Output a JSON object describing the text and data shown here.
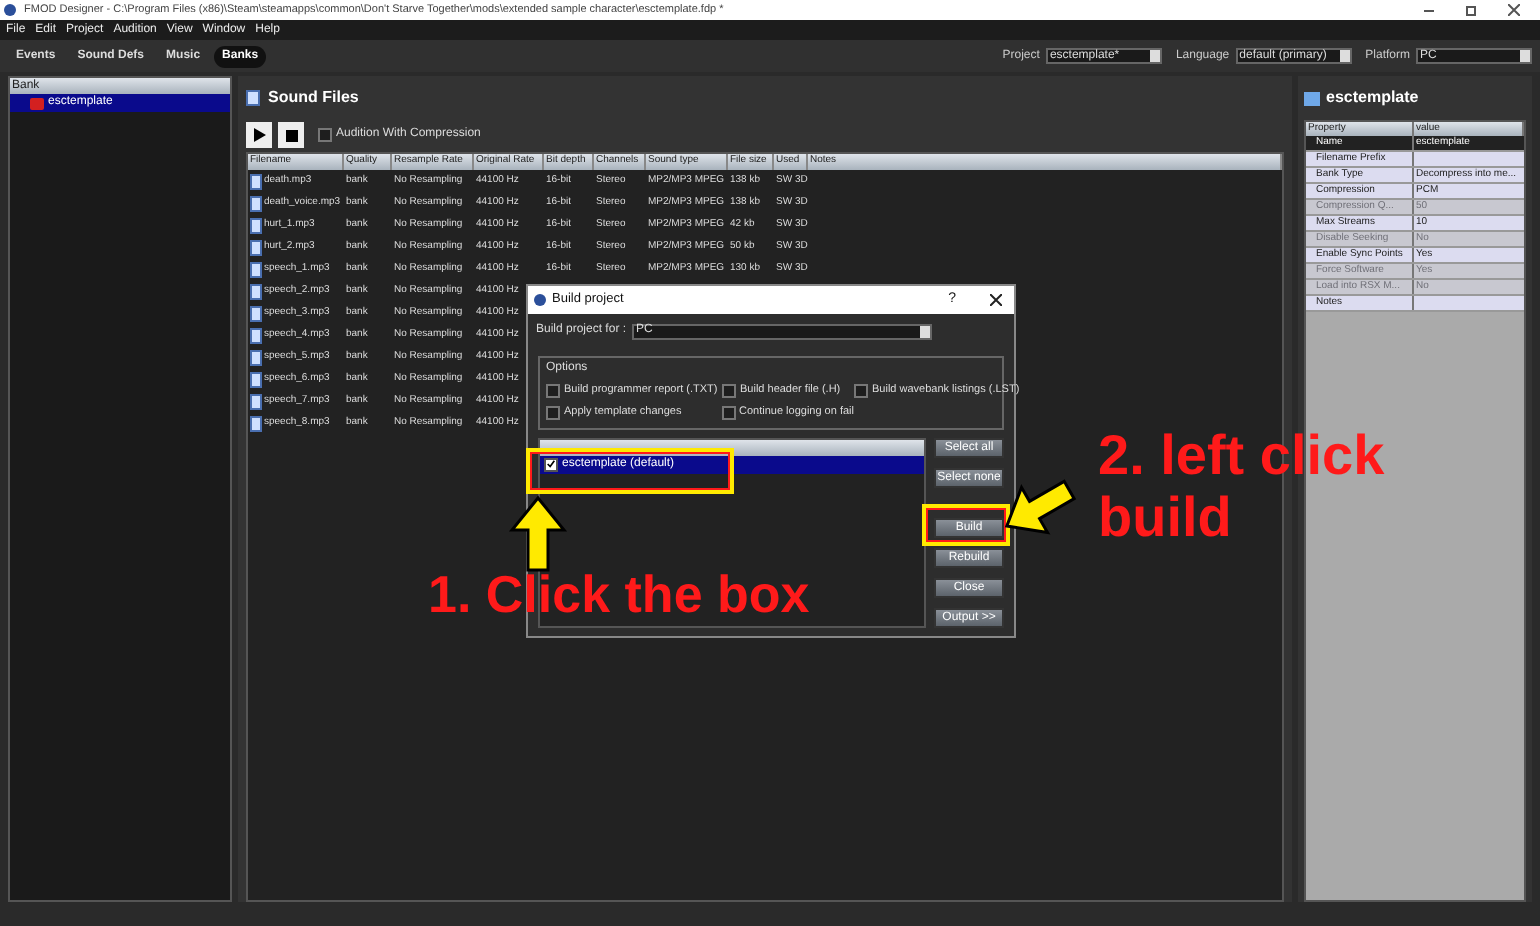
{
  "window": {
    "title": "FMOD Designer - C:\\Program Files (x86)\\Steam\\steamapps\\common\\Don't Starve Together\\mods\\extended sample character\\esctemplate.fdp *"
  },
  "menu": [
    "File",
    "Edit",
    "Project",
    "Audition",
    "View",
    "Window",
    "Help"
  ],
  "tabs": [
    {
      "label": "Events",
      "selected": false
    },
    {
      "label": "Sound Defs",
      "selected": false
    },
    {
      "label": "Music",
      "selected": false
    },
    {
      "label": "Banks",
      "selected": true
    }
  ],
  "selectors": [
    {
      "label": "Project",
      "value": "esctemplate*"
    },
    {
      "label": "Language",
      "value": "default (primary)"
    },
    {
      "label": "Platform",
      "value": "PC"
    }
  ],
  "tree": {
    "header": "Bank",
    "items": [
      {
        "label": "esctemplate",
        "selected": true
      }
    ]
  },
  "sound_files": {
    "title": "Sound Files",
    "audition_with_compression": {
      "label": "Audition With Compression",
      "checked": false
    },
    "columns": [
      "Filename",
      "Quality",
      "Resample Rate",
      "Original Rate",
      "Bit depth",
      "Channels",
      "Sound type",
      "File size",
      "Used",
      "Notes"
    ],
    "rows": [
      [
        "death.mp3",
        "bank",
        "No Resampling",
        "44100 Hz",
        "16-bit",
        "Stereo",
        "MP2/MP3 MPEG",
        "138 kb",
        "SW 3D"
      ],
      [
        "death_voice.mp3",
        "bank",
        "No Resampling",
        "44100 Hz",
        "16-bit",
        "Stereo",
        "MP2/MP3 MPEG",
        "138 kb",
        "SW 3D"
      ],
      [
        "hurt_1.mp3",
        "bank",
        "No Resampling",
        "44100 Hz",
        "16-bit",
        "Stereo",
        "MP2/MP3 MPEG",
        "42 kb",
        "SW 3D"
      ],
      [
        "hurt_2.mp3",
        "bank",
        "No Resampling",
        "44100 Hz",
        "16-bit",
        "Stereo",
        "MP2/MP3 MPEG",
        "50 kb",
        "SW 3D"
      ],
      [
        "speech_1.mp3",
        "bank",
        "No Resampling",
        "44100 Hz",
        "16-bit",
        "Stereo",
        "MP2/MP3 MPEG",
        "130 kb",
        "SW 3D"
      ],
      [
        "speech_2.mp3",
        "bank",
        "No Resampling",
        "44100 Hz"
      ],
      [
        "speech_3.mp3",
        "bank",
        "No Resampling",
        "44100 Hz"
      ],
      [
        "speech_4.mp3",
        "bank",
        "No Resampling",
        "44100 Hz"
      ],
      [
        "speech_5.mp3",
        "bank",
        "No Resampling",
        "44100 Hz"
      ],
      [
        "speech_6.mp3",
        "bank",
        "No Resampling",
        "44100 Hz"
      ],
      [
        "speech_7.mp3",
        "bank",
        "No Resampling",
        "44100 Hz"
      ],
      [
        "speech_8.mp3",
        "bank",
        "No Resampling",
        "44100 Hz"
      ]
    ]
  },
  "properties": {
    "title": "esctemplate",
    "columns": [
      "Property",
      "value"
    ],
    "rows": [
      {
        "name": "Name",
        "value": "esctemplate",
        "selected": true,
        "disabled": false
      },
      {
        "name": "Filename Prefix",
        "selected": false,
        "disabled": false
      },
      {
        "name": "Bank Type",
        "value": "Decompress into me...",
        "selected": false,
        "disabled": false
      },
      {
        "name": "Compression",
        "value": "PCM",
        "selected": false,
        "disabled": false
      },
      {
        "name": "Compression Q...",
        "value": "50",
        "selected": false,
        "disabled": true
      },
      {
        "name": "Max Streams",
        "value": "10",
        "selected": false,
        "disabled": false
      },
      {
        "name": "Disable Seeking",
        "value": "No",
        "selected": false,
        "disabled": true
      },
      {
        "name": "Enable Sync Points",
        "value": "Yes",
        "selected": false,
        "disabled": false
      },
      {
        "name": "Force Software",
        "value": "Yes",
        "selected": false,
        "disabled": true
      },
      {
        "name": "Load into RSX M...",
        "value": "No",
        "selected": false,
        "disabled": true
      },
      {
        "name": "Notes",
        "selected": false,
        "disabled": false
      }
    ]
  },
  "dialog": {
    "title": "Build project",
    "help": "?",
    "build_for": {
      "label": "Build project for :",
      "value": "PC"
    },
    "options_title": "Options",
    "options": [
      {
        "label": "Build programmer report (.TXT)",
        "checked": false
      },
      {
        "label": "Build header file (.H)",
        "checked": false
      },
      {
        "label": "Build wavebank listings (.LST)",
        "checked": false
      },
      {
        "label": "Apply template changes",
        "checked": false
      },
      {
        "label": "Continue logging on fail",
        "checked": false
      }
    ],
    "banks": [
      {
        "label": "esctemplate (default)",
        "checked": true,
        "selected": true
      }
    ],
    "buttons": [
      "Select all",
      "Select none",
      "Build",
      "Rebuild",
      "Close",
      "Output >>"
    ]
  },
  "annotations": [
    "1. Click the box",
    "2. left click build"
  ]
}
